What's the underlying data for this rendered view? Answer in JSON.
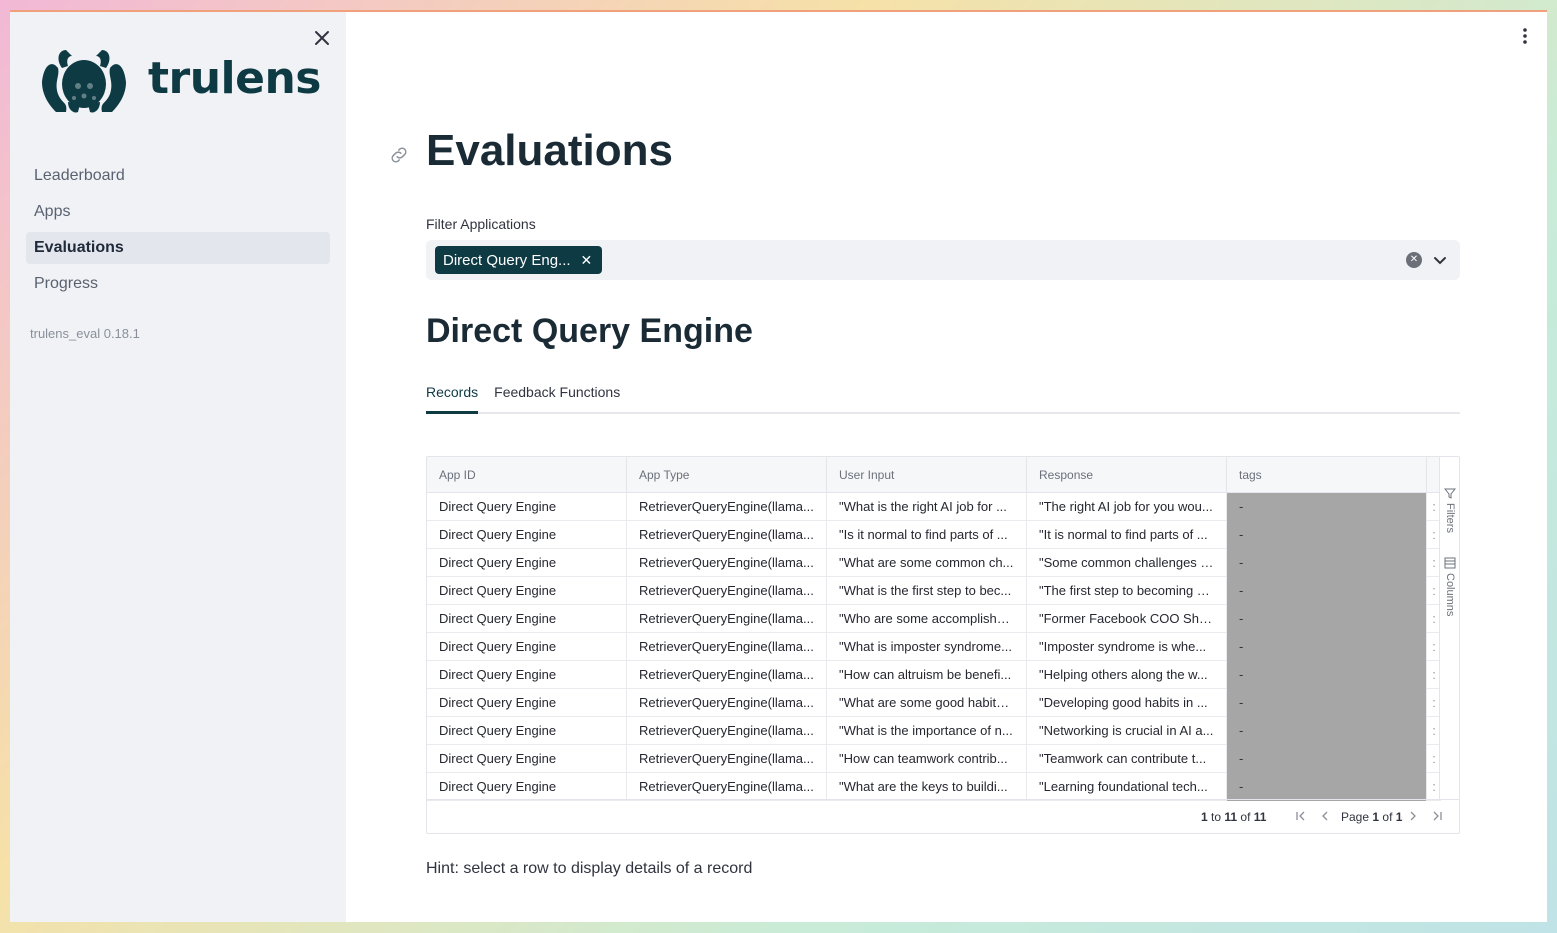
{
  "sidebar": {
    "brand": "trulens",
    "nav": [
      "Leaderboard",
      "Apps",
      "Evaluations",
      "Progress"
    ],
    "active_nav": "Evaluations",
    "version": "trulens_eval 0.18.1"
  },
  "page": {
    "title": "Evaluations",
    "filter_label": "Filter Applications",
    "selected_chip": "Direct Query Eng...",
    "app_title": "Direct Query Engine",
    "tabs": [
      "Records",
      "Feedback Functions"
    ],
    "active_tab": "Records"
  },
  "grid": {
    "columns": [
      "App ID",
      "App Type",
      "User Input",
      "Response",
      "tags",
      ""
    ],
    "side_buttons": {
      "filters": "Filters",
      "columns": "Columns"
    },
    "rows": [
      {
        "app_id": "Direct Query Engine",
        "app_type": "RetrieverQueryEngine(llama...",
        "input": "\"What is the right AI job for ...",
        "response": "\"The right AI job for you wou...",
        "tags": "-"
      },
      {
        "app_id": "Direct Query Engine",
        "app_type": "RetrieverQueryEngine(llama...",
        "input": "\"Is it normal to find parts of ...",
        "response": "\"It is normal to find parts of ...",
        "tags": "-"
      },
      {
        "app_id": "Direct Query Engine",
        "app_type": "RetrieverQueryEngine(llama...",
        "input": "\"What are some common ch...",
        "response": "\"Some common challenges i...",
        "tags": "-"
      },
      {
        "app_id": "Direct Query Engine",
        "app_type": "RetrieverQueryEngine(llama...",
        "input": "\"What is the first step to bec...",
        "response": "\"The first step to becoming g...",
        "tags": "-"
      },
      {
        "app_id": "Direct Query Engine",
        "app_type": "RetrieverQueryEngine(llama...",
        "input": "\"Who are some accomplishe...",
        "response": "\"Former Facebook COO Sher...",
        "tags": "-"
      },
      {
        "app_id": "Direct Query Engine",
        "app_type": "RetrieverQueryEngine(llama...",
        "input": "\"What is imposter syndrome...",
        "response": "\"Imposter syndrome is whe...",
        "tags": "-"
      },
      {
        "app_id": "Direct Query Engine",
        "app_type": "RetrieverQueryEngine(llama...",
        "input": "\"How can altruism be benefi...",
        "response": "\"Helping others along the w...",
        "tags": "-"
      },
      {
        "app_id": "Direct Query Engine",
        "app_type": "RetrieverQueryEngine(llama...",
        "input": "\"What are some good habits ...",
        "response": "\"Developing good habits in ...",
        "tags": "-"
      },
      {
        "app_id": "Direct Query Engine",
        "app_type": "RetrieverQueryEngine(llama...",
        "input": "\"What is the importance of n...",
        "response": "\"Networking is crucial in AI a...",
        "tags": "-"
      },
      {
        "app_id": "Direct Query Engine",
        "app_type": "RetrieverQueryEngine(llama...",
        "input": "\"How can teamwork contrib...",
        "response": "\"Teamwork can contribute t...",
        "tags": "-"
      },
      {
        "app_id": "Direct Query Engine",
        "app_type": "RetrieverQueryEngine(llama...",
        "input": "\"What are the keys to buildi...",
        "response": "\"Learning foundational tech...",
        "tags": "-"
      }
    ],
    "pager": {
      "from": "1",
      "to": "11",
      "total": "11",
      "page": "1",
      "pages": "1",
      "to_word": "to",
      "of_word": "of",
      "page_word": "Page"
    }
  },
  "hint": "Hint: select a row to display details of a record",
  "colors": {
    "brand": "#0e3a44",
    "sidebar_bg": "#f0f2f6",
    "tags_cell": "#a6a6a6"
  },
  "icons": [
    "close-icon",
    "logo-squid-icon",
    "link-icon",
    "kebab-menu-icon",
    "clear-icon",
    "chevron-down-icon",
    "filter-icon",
    "columns-icon",
    "first-page-icon",
    "prev-page-icon",
    "next-page-icon",
    "last-page-icon"
  ]
}
